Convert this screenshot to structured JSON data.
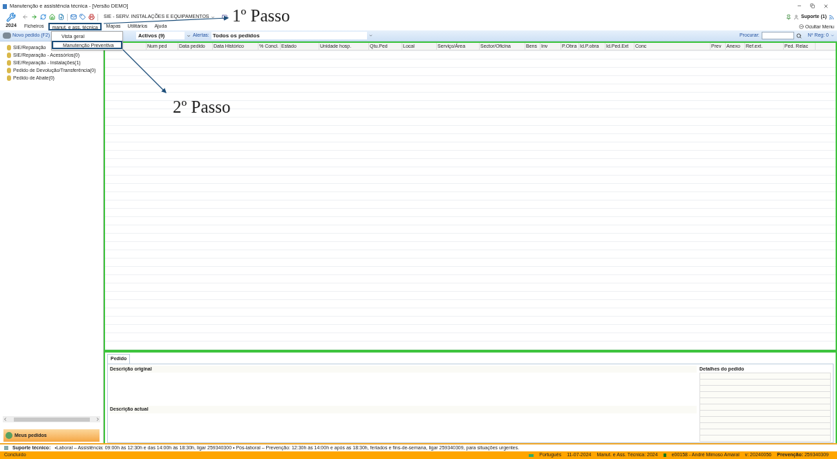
{
  "window": {
    "title": "Manutenção e assistência técnica - [Versão DEMO]"
  },
  "toolbar": {
    "year": "2024",
    "entity": "SIE - SERV. INSTALAÇÕES E EQUIPAMENTOS",
    "support": "Suporte (1)"
  },
  "menu": {
    "items": [
      {
        "label": "Ficheiros",
        "selected": false
      },
      {
        "label": "manut. e ass. técnica",
        "selected": true
      },
      {
        "label": "Mapas",
        "selected": false
      },
      {
        "label": "Utilitários",
        "selected": false
      },
      {
        "label": "Ajuda",
        "selected": false
      }
    ],
    "hide_menu": "Ocultar Menu"
  },
  "dropdown": {
    "items": [
      {
        "label": "Vista geral",
        "selected": false
      },
      {
        "label": "Manutenção Preventiva",
        "selected": true
      }
    ]
  },
  "filter_bar": {
    "new_button": "Novo pedido (F2)",
    "state_value": "Activos (9)",
    "alerts_label": "Alertas:",
    "alerts_value": "Todos os pedidos",
    "search_label": "Procurar:",
    "records": "Nº Reg: 0"
  },
  "sidebar": {
    "items": [
      {
        "label": "SIE/Reparação"
      },
      {
        "label": "SIE/Reparação - Acessórios(0)"
      },
      {
        "label": "SIE/Reparação - Instalações(1)"
      },
      {
        "label": "Pedido de Devolução/Transferência(0)"
      },
      {
        "label": "Pedido de Abate(0)"
      }
    ],
    "my_orders": "Meus pedidos"
  },
  "table": {
    "columns": [
      "",
      "Num ped",
      "Data pedido",
      "Data Histórico",
      "% Concl.",
      "Estado",
      "Unidade hosp.",
      "Qtu.Ped",
      "Local",
      "Serviço/Área",
      "Sector/Oficina",
      "Bens",
      "Inv",
      "P.Obra",
      "Id.P.obra",
      "Id.Ped.Ext",
      "Conc",
      "Prev",
      "Anexo",
      "Ref.ext.",
      "Ped. Relac"
    ]
  },
  "detail": {
    "tab": "Pedido",
    "original": "Descrição original",
    "current": "Descrição actual",
    "details": "Detalhes do pedido"
  },
  "support_line": {
    "label": "Suporte técnico:",
    "text": "•Laboral – Assistência: 09:00h às 12:30h e das 14:00h às 18:30h, ligar 259340300 • Pós-laboral – Prevenção: 12:30h às 14:00h e após as 18:30h, feriados e fins-de-semana, ligar 259340309, para situações urgentes."
  },
  "status_bar": {
    "left": "Concluído",
    "language": "Português",
    "date": "11-07-2024",
    "module": "Manut. e Ass. Técnica: 2024",
    "user": "e00158 - André Mimoso Amaral",
    "version": "v: 20240056",
    "prevention": "**Prevenção:** 259340309"
  },
  "annotations": [
    {
      "label": "1º Passo"
    },
    {
      "label": "2º Passo"
    }
  ]
}
